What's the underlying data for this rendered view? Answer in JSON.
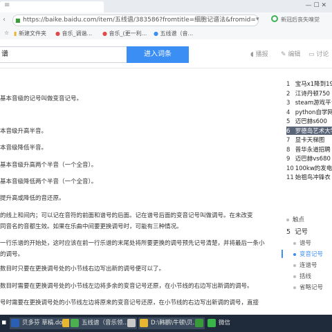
{
  "browser": {
    "url": "https://baike.baidu.com/item/五线谱/383586?fromtitle=细胞记谱法&fromid=",
    "right_status": "新冠后丧失嗅觉",
    "bookmarks": [
      "新建文件夹",
      "音乐_调谐...",
      "音乐_(更一利...",
      "五线谱（音..."
    ]
  },
  "search": {
    "value": "谱",
    "button": "进入词条",
    "tools": [
      "播报",
      "编辑",
      "讨论"
    ]
  },
  "content": {
    "lines": [
      {
        "text": "基本音级的记号叫做变音记号。",
        "link": "基本音级"
      },
      {
        "text": "本音级升高半音。"
      },
      {
        "text": "本音级降低半音。"
      },
      {
        "text": "基本音级升高两个半音（一个全音）。"
      },
      {
        "text": "基本音级降低两个半音（一个全音）。"
      },
      {
        "text": "提升高或降低的音还原。"
      },
      {
        "text": "的线上和间内；可以记在音符的前面和谱号的后面。记在谱号后面的变音记号叫做调号。在未改变"
      },
      {
        "text": "同音名的音都生效。如果在乐曲中间要更换调号时，可能有三种情况。"
      },
      {
        "text": "一行乐谱的开始处，这时应该在前一行乐谱的末尾处将所要更换的调号预先记号清楚，并将最后一条小"
      },
      {
        "text": "的调号。"
      },
      {
        "text": "数目时只要在更换调号处的小节线右边写出新的调号便可以了。"
      },
      {
        "text": "数目时需要在更换调号处的小节线左边将多余的变音记号还原，在小节线的右边写出新调的调号。"
      },
      {
        "text": "号时需要在更换调号处的小节线左边将原来的变音记号还原，在小节线的右边写出新调的调号，直接"
      }
    ]
  },
  "hot_list": [
    {
      "rank": "1",
      "text": "宝马x1降到19万"
    },
    {
      "rank": "2",
      "text": "江诗丹顿750"
    },
    {
      "rank": "3",
      "text": "steam游戏平台"
    },
    {
      "rank": "4",
      "text": "python自学网"
    },
    {
      "rank": "5",
      "text": "迈巴赫s600"
    },
    {
      "rank": "6",
      "text": "罗德岛艺术大学"
    },
    {
      "rank": "7",
      "text": "显卡天梯图"
    },
    {
      "rank": "8",
      "text": "普华永道招聘"
    },
    {
      "rank": "9",
      "text": "迈巴赫vs680"
    },
    {
      "rank": "10",
      "text": "100kw的发电机"
    },
    {
      "rank": "11",
      "text": "始祖鸟冲锋衣"
    }
  ],
  "toc": {
    "above": "触点",
    "section_num": "5",
    "section": "记号",
    "items": [
      "谱号",
      "变音记号",
      "连谱号",
      "括线",
      "省略记号"
    ],
    "current": "变音记号"
  },
  "taskbar": [
    {
      "label": "贝多芬 草稿.docx...",
      "color": "#2b5fb4"
    },
    {
      "label": "",
      "color": "#e6b531"
    },
    {
      "label": "五线谱（音乐领...",
      "color": "#4caf50"
    },
    {
      "label": "",
      "color": "#c9c9c9"
    },
    {
      "label": "D:\\韩鹏\\牛顿\\贝...",
      "color": "#e6b531"
    },
    {
      "label": "",
      "color": "#3a9a3a"
    },
    {
      "label": "微信",
      "color": "#3ab54a"
    }
  ]
}
